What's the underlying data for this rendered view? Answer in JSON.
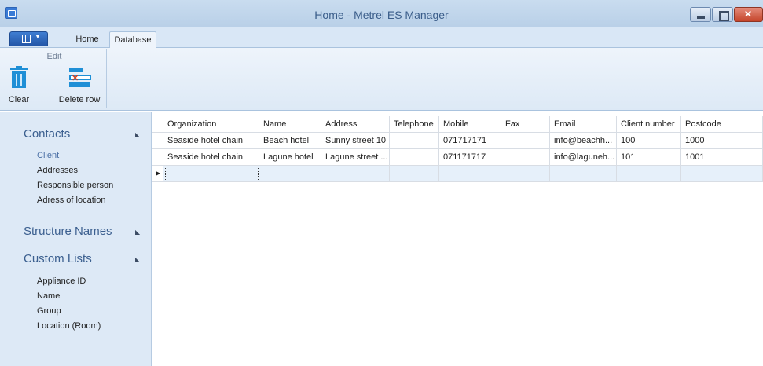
{
  "window": {
    "title": "Home - Metrel ES Manager"
  },
  "ribbon": {
    "tabs": [
      {
        "label": "Home"
      },
      {
        "label": "Database"
      }
    ],
    "groups": [
      {
        "title": "Edit",
        "buttons": [
          {
            "label": "Clear",
            "icon": "trash-icon"
          },
          {
            "label": "Delete row",
            "icon": "delete-row-icon"
          }
        ]
      }
    ]
  },
  "sidebar": {
    "sections": [
      {
        "title": "Contacts",
        "items": [
          {
            "label": "Client",
            "active": true
          },
          {
            "label": "Addresses"
          },
          {
            "label": "Responsible person"
          },
          {
            "label": "Adress of location"
          }
        ]
      },
      {
        "title": "Structure Names",
        "items": []
      },
      {
        "title": "Custom Lists",
        "items": [
          {
            "label": "Appliance ID"
          },
          {
            "label": "Name"
          },
          {
            "label": "Group"
          },
          {
            "label": "Location (Room)"
          }
        ]
      }
    ]
  },
  "grid": {
    "columns": [
      "Organization",
      "Name",
      "Address",
      "Telephone",
      "Mobile",
      "Fax",
      "Email",
      "Client number",
      "Postcode"
    ],
    "rows": [
      [
        "Seaside hotel chain",
        "Beach hotel",
        "Sunny street 10",
        "",
        "071717171",
        "",
        "info@beachh...",
        "100",
        "1000"
      ],
      [
        "Seaside hotel chain",
        "Lagune hotel",
        "Lagune street ...",
        "",
        "071171717",
        "",
        "info@laguneh...",
        "101",
        "1001"
      ]
    ]
  },
  "colors": {
    "accent": "#1f8fd6",
    "sidebar_bg": "#dde9f6",
    "section_heading": "#3b5f8f",
    "new_row_bg": "#e6f0fa"
  }
}
